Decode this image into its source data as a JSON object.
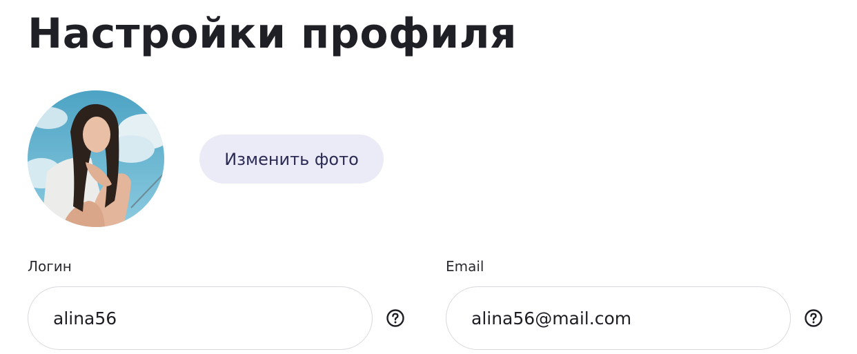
{
  "page": {
    "title": "Настройки профиля"
  },
  "avatar": {
    "alt": "Фото профиля"
  },
  "change_photo": {
    "label": "Изменить фото"
  },
  "login": {
    "label": "Логин",
    "value": "alina56",
    "help_icon": "question-circle-icon"
  },
  "email": {
    "label": "Email",
    "value": "alina56@mail.com",
    "help_icon": "question-circle-icon"
  },
  "colors": {
    "button_bg": "#ebebf7",
    "button_text": "#2b2b55",
    "field_border": "#d8d8de",
    "title": "#1f1f26"
  }
}
